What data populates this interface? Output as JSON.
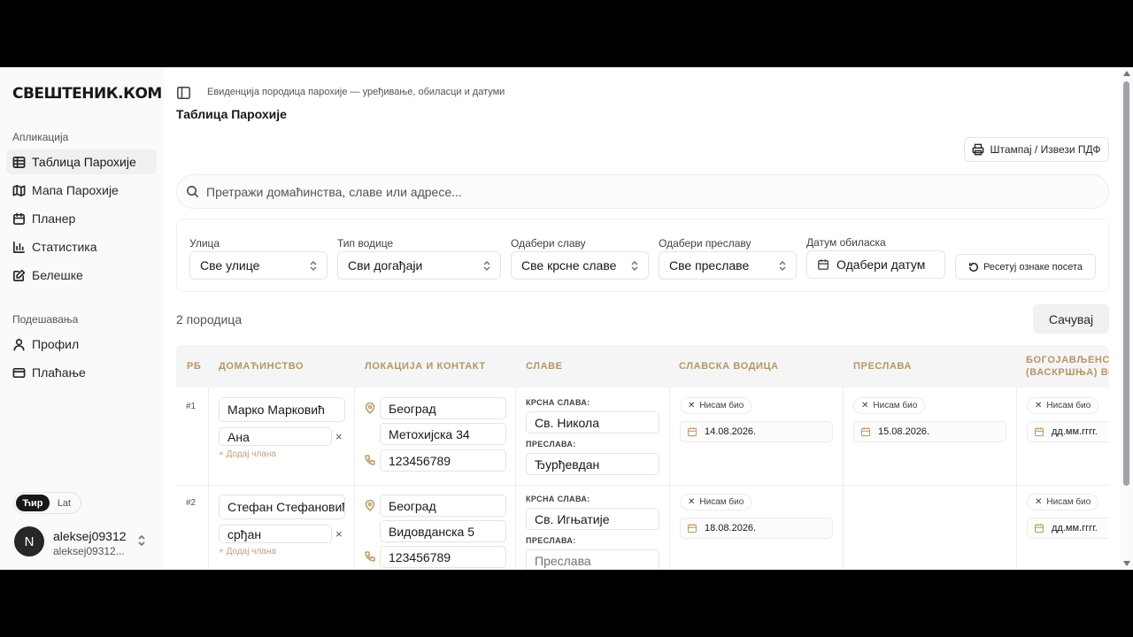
{
  "app": {
    "logo": "СВЕШТЕНИК.КОМ"
  },
  "sidebar": {
    "group_app": "Апликација",
    "items": [
      {
        "label": "Таблица Парохије",
        "icon": "table-icon",
        "active": true
      },
      {
        "label": "Мапа Парохије",
        "icon": "map-icon"
      },
      {
        "label": "Планер",
        "icon": "calendar-icon"
      },
      {
        "label": "Статистика",
        "icon": "chart-icon"
      },
      {
        "label": "Белешке",
        "icon": "notes-icon"
      }
    ],
    "group_settings": "Подешавања",
    "settings": [
      {
        "label": "Профил",
        "icon": "user-icon"
      },
      {
        "label": "Плаћање",
        "icon": "credit-card-icon"
      }
    ],
    "lang": {
      "cyr": "Ћир",
      "lat": "Lat"
    },
    "user": {
      "initial": "N",
      "name": "aleksej09312",
      "email": "aleksej09312..."
    }
  },
  "header": {
    "breadcrumb": "Евиденција породица парохије — уређивање, обиласци и датуми",
    "title": "Таблица Парохије",
    "print_label": "Штампај / Извези ПДФ"
  },
  "search": {
    "placeholder": "Претражи домаћинства, славе или адресе..."
  },
  "filters": {
    "street": {
      "label": "Улица",
      "value": "Све улице"
    },
    "water": {
      "label": "Тип водице",
      "value": "Сви догађаји"
    },
    "slava": {
      "label": "Одабери славу",
      "value": "Све крсне славе"
    },
    "preslava": {
      "label": "Одабери преславу",
      "value": "Све преславе"
    },
    "date": {
      "label": "Датум обиласка",
      "value": "Одабери датум"
    },
    "reset_label": "Ресетуј ознаке посета"
  },
  "summary": {
    "count": "2 породица",
    "save_label": "Сачувај"
  },
  "table": {
    "headers": {
      "rb": "РБ",
      "household": "ДОМАЋИНСТВО",
      "location": "ЛОКАЦИЈА И КОНТАКТ",
      "slave": "СЛАВЕ",
      "water": "СЛАВСКА ВОДИЦА",
      "preslava": "ПРЕСЛАВА",
      "epiphany_1": "БОГОЈАВЉЕНСКА",
      "epiphany_2": "(ВАСКРШЊА) ВОДИЦА"
    },
    "krsna_label": "КРСНА СЛАВА:",
    "preslava_label": "ПРЕСЛАВА:",
    "add_member": "+ Додај члана",
    "not_visited": "Нисам био",
    "rows": [
      {
        "num": "#1",
        "head": "Марко Марковић",
        "member": "Ана",
        "city": "Београд",
        "address": "Метохијска 34",
        "phone": "123456789",
        "krsna": "Св. Никола",
        "preslava": "Ђурђевдан",
        "preslava_placeholder": "",
        "water_date": "14.08.2026.",
        "preslava_date": "15.08.2026.",
        "epiphany_date": "дд.мм.гггг."
      },
      {
        "num": "#2",
        "head": "Стефан Стефановић",
        "member": "срђан",
        "city": "Београд",
        "address": "Видовданска 5",
        "phone": "123456789",
        "krsna": "Св. Игњатије",
        "preslava": "",
        "preslava_placeholder": "Преслава",
        "water_date": "18.08.2026.",
        "epiphany_date": "дд.мм.гггг."
      }
    ]
  }
}
